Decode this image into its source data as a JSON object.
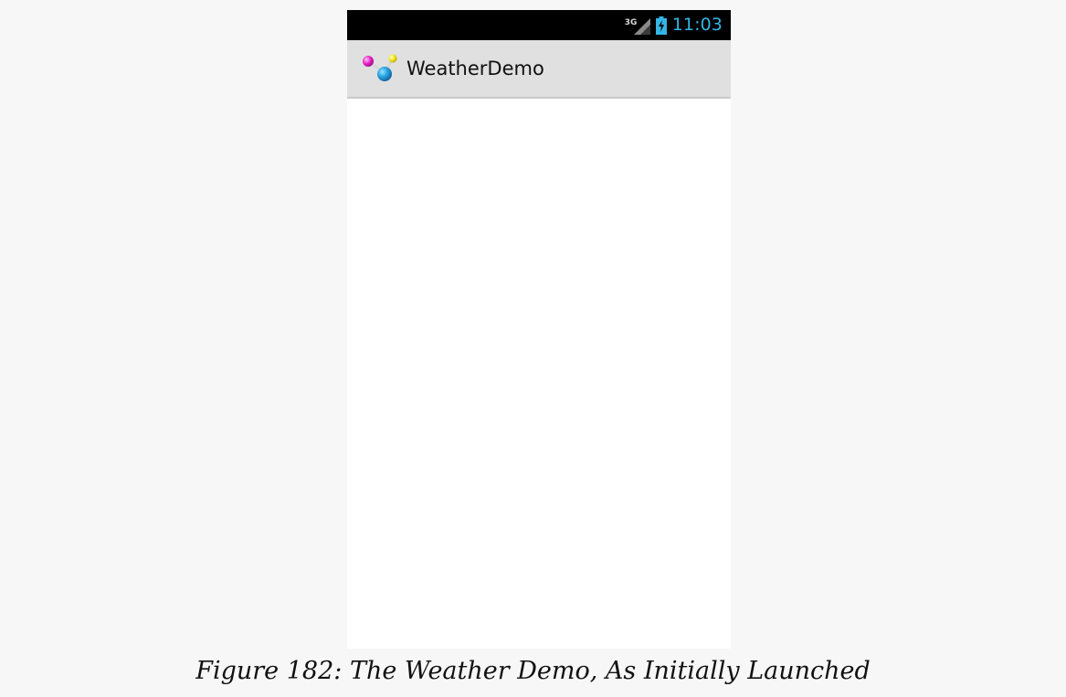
{
  "status_bar": {
    "network_type": "3G",
    "time": "11:03",
    "signal_icon": "signal-strength-icon",
    "battery_icon": "battery-charging-icon",
    "colors": {
      "background": "#000000",
      "time": "#33b5e5"
    }
  },
  "action_bar": {
    "icon": "weather-demo-app-icon",
    "title": "WeatherDemo",
    "background": "#e0e0e0"
  },
  "caption": "Figure 182: The Weather Demo, As Initially Launched"
}
